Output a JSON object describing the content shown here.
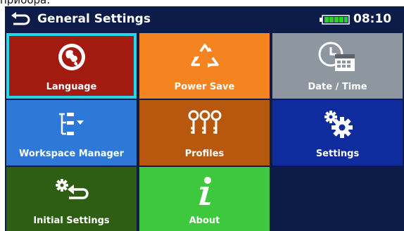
{
  "caption": "прибора:",
  "header": {
    "back_icon": "back-arrow-icon",
    "title": "General Settings",
    "battery_icon": "battery-icon",
    "time": "08:10"
  },
  "tiles": [
    {
      "label": "Language",
      "icon": "globe-icon",
      "color": "#a31a10",
      "selected": true
    },
    {
      "label": "Power Save",
      "icon": "recycle-icon",
      "color": "#f5831f"
    },
    {
      "label": "Date / Time",
      "icon": "clock-calendar-icon",
      "color": "#8e969f"
    },
    {
      "label": "Workspace Manager",
      "icon": "workspace-tree-icon",
      "color": "#2e78d8"
    },
    {
      "label": "Profiles",
      "icon": "profiles-keys-icon",
      "color": "#b8580f"
    },
    {
      "label": "Settings",
      "icon": "gears-icon",
      "color": "#0f2c9e"
    },
    {
      "label": "Initial Settings",
      "icon": "initial-settings-icon",
      "color": "#2e5e12"
    },
    {
      "label": "About",
      "icon": "info-icon",
      "color": "#3ec83e"
    }
  ],
  "colors": {
    "background": "#0c1b48",
    "selection_border": "#26d6e6"
  }
}
